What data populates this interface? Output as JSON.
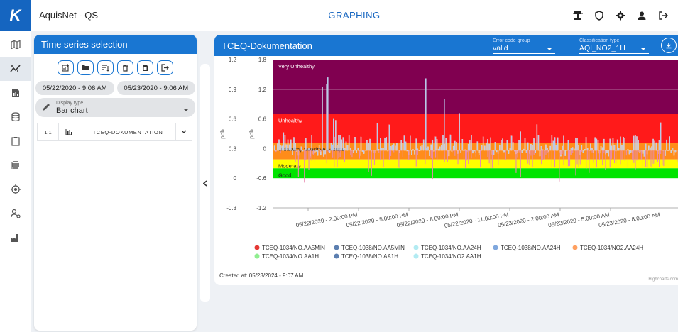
{
  "app": {
    "logo": "K",
    "title": "AquisNet - QS",
    "page_title": "GRAPHING"
  },
  "top_icons": [
    "marker-icon",
    "shield-icon",
    "gear-icon",
    "user-icon",
    "logout-icon"
  ],
  "nav_items": [
    "map-icon",
    "graph-icon",
    "report-icon",
    "database-icon",
    "clipboard-icon",
    "layers-icon",
    "target-icon",
    "user-settings-icon",
    "factory-icon"
  ],
  "selection": {
    "title": "Time series selection",
    "tools": [
      "add-chart-icon",
      "folder-icon",
      "sort-icon",
      "delete-icon",
      "pdf-icon",
      "export-icon"
    ],
    "start_date": "05/22/2020 - 9:06 AM",
    "end_date": "05/23/2020 - 9:06 AM",
    "display_type_label": "Display type",
    "display_type_value": "Bar chart",
    "series_row": {
      "index": "1|1",
      "name": "TCEQ-DOKUMENTATION"
    }
  },
  "chart_panel": {
    "title": "TCEQ-Dokumentation",
    "error_code_label": "Error code group",
    "error_code_value": "valid",
    "classification_label": "Classification type",
    "classification_value": "AQI_NO2_1H",
    "created": "Created at: 05/23/2024 - 9:07 AM",
    "credits": "Highcharts.com"
  },
  "chart_data": {
    "type": "bar",
    "ylabel_left": "ppb",
    "ylabel_inner": "ppb",
    "y_axes": {
      "outer": {
        "ticks": [
          "1.2",
          "0.9",
          "0.6",
          "0.3",
          "0",
          "-0.3"
        ],
        "range": [
          -0.3,
          1.2
        ]
      },
      "inner": {
        "ticks": [
          "1.8",
          "1.2",
          "0.6",
          "0",
          "-0.6",
          "-1.2"
        ],
        "range": [
          -1.2,
          1.8
        ]
      }
    },
    "x_ticks": [
      "05/22/2020 - 2:00:00 PM",
      "05/22/2020 - 5:00:00 PM",
      "05/22/2020 - 8:00:00 PM",
      "05/22/2020 - 11:00:00 PM",
      "05/23/2020 - 2:00:00 AM",
      "05/23/2020 - 5:00:00 AM",
      "05/23/2020 - 8:00:00 AM"
    ],
    "bands": [
      {
        "label": "Very Unhealthy",
        "from": 0.65,
        "to": 1.2,
        "color": "#800050"
      },
      {
        "label": "Unhealthy",
        "from": 0.36,
        "to": 0.65,
        "color": "#ff1a1a"
      },
      {
        "label": "Unhealthy Sensitive Groups",
        "from": 0.19,
        "to": 0.36,
        "color": "#ff8c1a"
      },
      {
        "label": "Moderate",
        "from": 0.1,
        "to": 0.19,
        "color": "#ffff00"
      },
      {
        "label": "Good",
        "from": 0.0,
        "to": 0.1,
        "color": "#00e400"
      }
    ],
    "dividers": [
      0.9
    ],
    "series": [
      {
        "name": "TCEQ-1034/NO.AA5MIN",
        "color": "#e53935"
      },
      {
        "name": "TCEQ-1038/NO.AA5MIN",
        "color": "#5c7fb0"
      },
      {
        "name": "TCEQ-1034/NO.AA24H",
        "color": "#b2ebf2"
      },
      {
        "name": "TCEQ-1038/NO.AA24H",
        "color": "#7fa7dd"
      },
      {
        "name": "TCEQ-1034/NO2.AA24H",
        "color": "#ffa060"
      },
      {
        "name": "TCEQ-1034/NO.AA1H",
        "color": "#90ee90"
      },
      {
        "name": "TCEQ-1038/NO.AA1H",
        "color": "#5c7fb0"
      },
      {
        "name": "TCEQ-1034/NO2.AA1H",
        "color": "#b2ebf2"
      }
    ]
  }
}
